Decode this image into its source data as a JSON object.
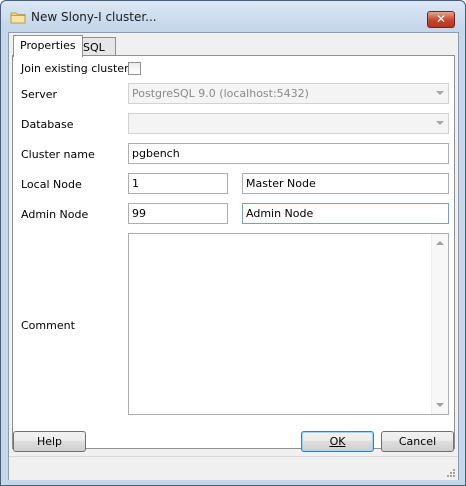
{
  "window": {
    "title": "New Slony-I cluster..."
  },
  "tabs": [
    {
      "label": "Properties"
    },
    {
      "label": "SQL"
    }
  ],
  "form": {
    "join_label": "Join existing cluster",
    "server_label": "Server",
    "server_value": "PostgreSQL 9.0 (localhost:5432)",
    "database_label": "Database",
    "database_value": "",
    "cluster_name_label": "Cluster name",
    "cluster_name_value": "pgbench",
    "local_node_label": "Local Node",
    "local_node_id": "1",
    "local_node_name": "Master Node",
    "admin_node_label": "Admin Node",
    "admin_node_id": "99",
    "admin_node_name": "Admin Node",
    "comment_label": "Comment",
    "comment_value": ""
  },
  "buttons": {
    "help": "Help",
    "ok": "OK",
    "cancel": "Cancel"
  }
}
